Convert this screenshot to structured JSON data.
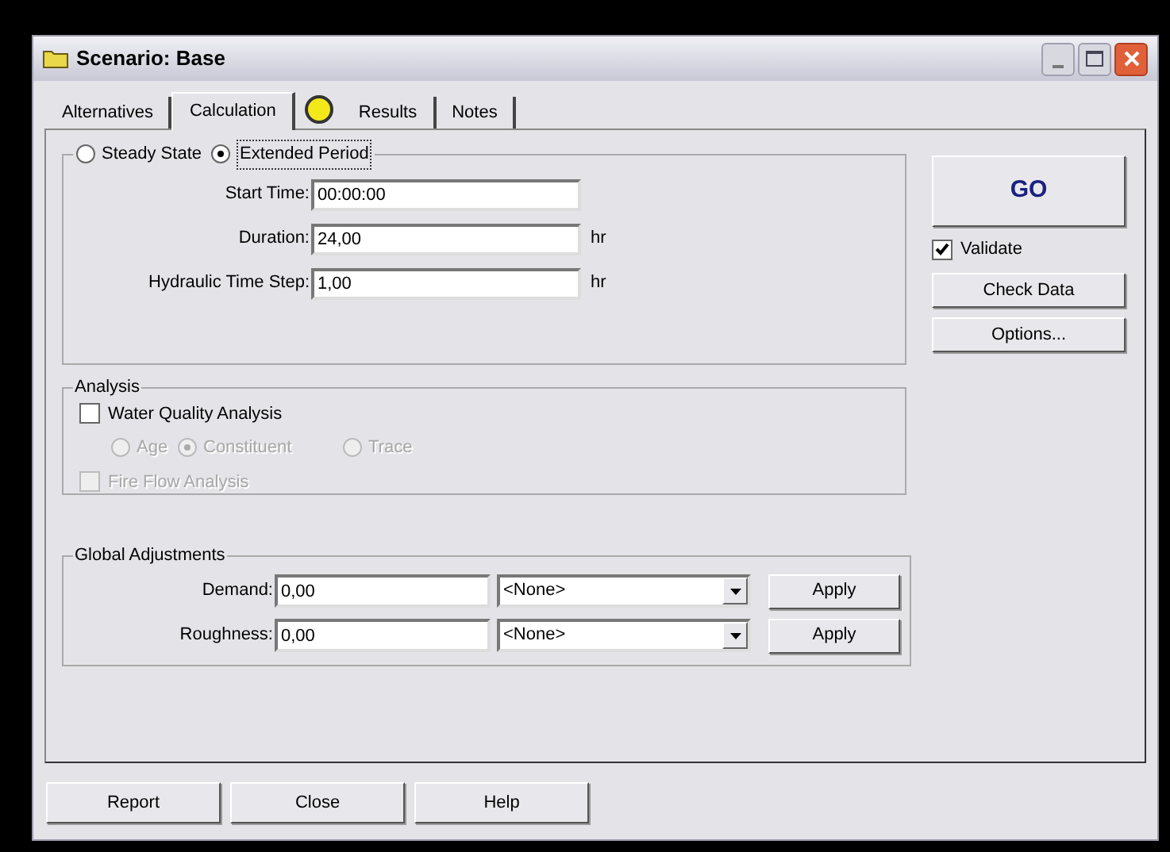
{
  "window": {
    "title": "Scenario: Base"
  },
  "tabs": [
    {
      "label": "Alternatives",
      "selected": false,
      "kind": "plain"
    },
    {
      "label": "Calculation",
      "selected": true,
      "kind": "plain"
    },
    {
      "label": "Results",
      "selected": false,
      "kind": "status"
    },
    {
      "label": "Notes",
      "selected": false,
      "kind": "plain"
    }
  ],
  "time_settings": {
    "modes": [
      {
        "label": "Steady State",
        "selected": false
      },
      {
        "label": "Extended Period",
        "selected": true
      }
    ],
    "fields": [
      {
        "label": "Start Time:",
        "value": "00:00:00"
      },
      {
        "label": "Duration:",
        "value": "24,00",
        "unit": "hr"
      },
      {
        "label": "Hydraulic Time Step:",
        "value": "1,00",
        "unit": "hr"
      }
    ]
  },
  "analysis": {
    "title": "Analysis",
    "water_quality": {
      "label": "Water Quality Analysis",
      "checked": false
    },
    "types": [
      {
        "label": "Age",
        "selected": false,
        "disabled": true
      },
      {
        "label": "Constituent",
        "selected": true,
        "disabled": true
      },
      {
        "label": "Trace",
        "selected": false,
        "disabled": true
      }
    ],
    "fire_flow": {
      "label": "Fire Flow Analysis",
      "checked": false,
      "disabled": true
    }
  },
  "global_adjustments": {
    "title": "Global Adjustments",
    "rows": [
      {
        "label": "Demand:",
        "value": "0,00",
        "selection": "<None>",
        "button": "Apply"
      },
      {
        "label": "Roughness:",
        "value": "0,00",
        "selection": "<None>",
        "button": "Apply"
      }
    ]
  },
  "side": {
    "go": "GO",
    "validate": {
      "label": "Validate",
      "checked": true
    },
    "buttons": [
      "Check Data",
      "Options..."
    ]
  },
  "footer_buttons": [
    "Report",
    "Close",
    "Help"
  ]
}
